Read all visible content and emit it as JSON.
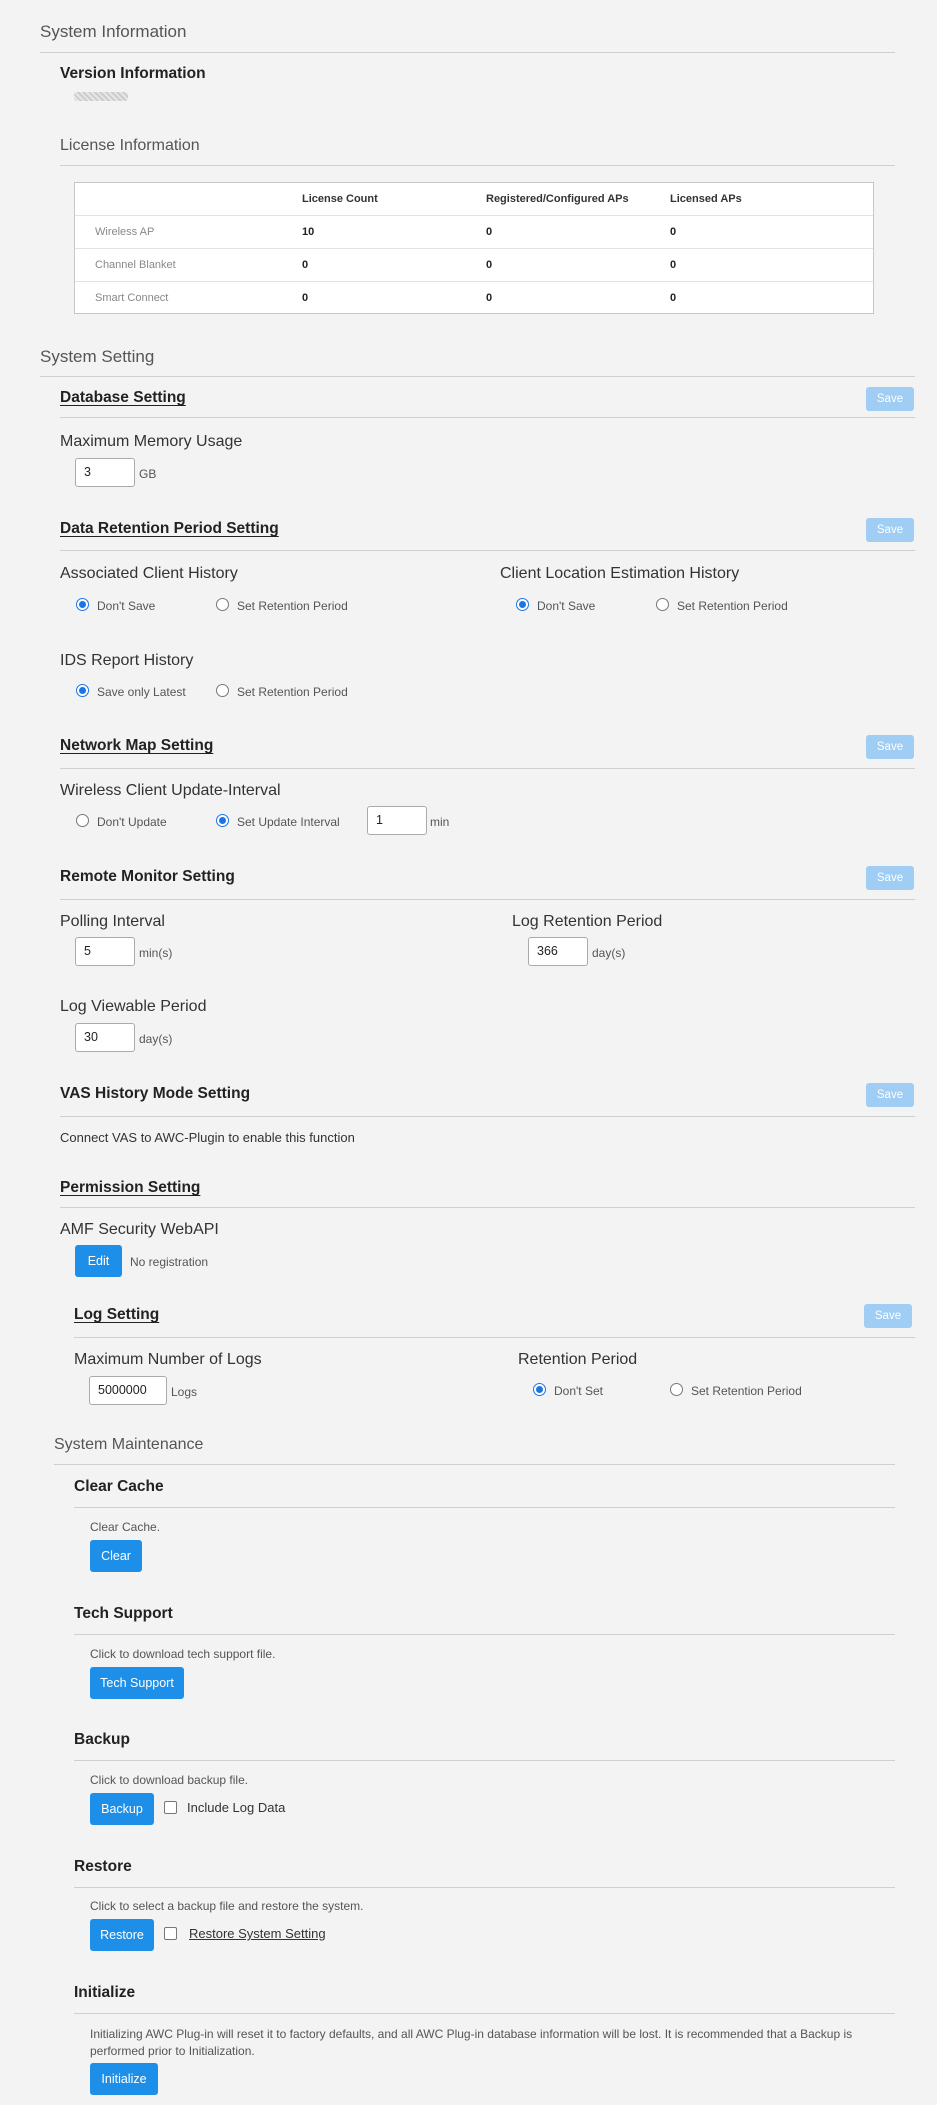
{
  "system_info": {
    "title": "System Information",
    "version_title": "Version Information",
    "license_title": "License Information",
    "license_table": {
      "headers": [
        "License Count",
        "Registered/Configured APs",
        "Licensed APs"
      ],
      "rows": [
        {
          "name": "Wireless AP",
          "values": [
            "10",
            "0",
            "0"
          ]
        },
        {
          "name": "Channel Blanket",
          "values": [
            "0",
            "0",
            "0"
          ]
        },
        {
          "name": "Smart Connect",
          "values": [
            "0",
            "0",
            "0"
          ]
        }
      ]
    }
  },
  "system_setting": {
    "title": "System Setting",
    "save_label": "Save",
    "database": {
      "title": "Database Setting",
      "max_memory_label": "Maximum Memory Usage",
      "max_memory_value": "3",
      "unit": "GB"
    },
    "data_retention": {
      "title": "Data Retention Period Setting",
      "assoc_label": "Associated Client History",
      "location_label": "Client Location Estimation History",
      "ids_label": "IDS Report History",
      "dont_save": "Don't Save",
      "set_retention": "Set Retention Period",
      "save_latest": "Save only Latest"
    },
    "network_map": {
      "title": "Network Map Setting",
      "interval_label": "Wireless Client Update-Interval",
      "dont_update": "Don't Update",
      "set_interval": "Set Update Interval",
      "interval_value": "1",
      "unit": "min"
    },
    "remote_monitor": {
      "title": "Remote Monitor Setting",
      "polling_label": "Polling Interval",
      "polling_value": "5",
      "polling_unit": "min(s)",
      "log_retention_label": "Log Retention Period",
      "log_retention_value": "366",
      "log_retention_unit": "day(s)",
      "log_view_label": "Log Viewable Period",
      "log_view_value": "30",
      "log_view_unit": "day(s)"
    },
    "vas": {
      "title": "VAS History Mode Setting",
      "message": "Connect VAS to AWC-Plugin to enable this function"
    },
    "permission": {
      "title": "Permission Setting",
      "api_label": "AMF Security WebAPI",
      "edit_label": "Edit",
      "status": "No registration"
    },
    "log_setting": {
      "title": "Log Setting",
      "max_logs_label": "Maximum Number of Logs",
      "max_logs_value": "5000000",
      "logs_unit": "Logs",
      "retention_label": "Retention Period",
      "dont_set": "Don't Set",
      "set_retention": "Set Retention Period"
    }
  },
  "maintenance": {
    "title": "System Maintenance",
    "clear_cache": {
      "title": "Clear Cache",
      "desc": "Clear Cache.",
      "button": "Clear"
    },
    "tech_support": {
      "title": "Tech Support",
      "desc": "Click to download tech support file.",
      "button": "Tech Support"
    },
    "backup": {
      "title": "Backup",
      "desc": "Click to download backup file.",
      "button": "Backup",
      "checkbox": "Include Log Data"
    },
    "restore": {
      "title": "Restore",
      "desc": "Click to select a backup file and restore the system.",
      "button": "Restore",
      "checkbox": "Restore System Setting"
    },
    "initialize": {
      "title": "Initialize",
      "desc": "Initializing AWC Plug-in will reset it to factory defaults, and all AWC Plug-in database information will be lost. It is recommended that a Backup is performed prior to Initialization.",
      "button": "Initialize"
    }
  }
}
